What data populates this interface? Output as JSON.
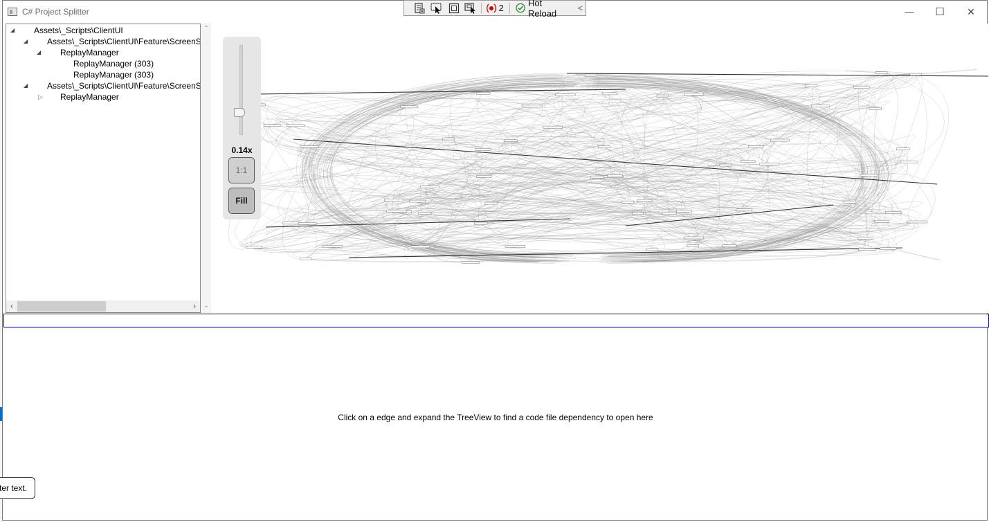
{
  "window": {
    "title": "C# Project Splitter",
    "minimize_glyph": "—",
    "maximize_glyph": "☐",
    "close_glyph": "✕"
  },
  "debug_toolbar": {
    "icons": [
      "live-visual-tree-icon",
      "select-element-icon",
      "display-layout-adorners-icon",
      "track-focus-icon"
    ],
    "issue_count": "2",
    "hot_reload_label": "Hot Reload",
    "collapse_glyph": "<"
  },
  "tree": {
    "items": [
      {
        "label": "Assets\\_Scripts\\ClientUI",
        "level": 0,
        "state": "expanded"
      },
      {
        "label": "Assets\\_Scripts\\ClientUI\\Feature\\ScreenSp",
        "level": 1,
        "state": "expanded"
      },
      {
        "label": "ReplayManager",
        "level": 2,
        "state": "expanded"
      },
      {
        "label": "ReplayManager (303)",
        "level": 3,
        "state": "leaf"
      },
      {
        "label": "ReplayManager (303)",
        "level": 3,
        "state": "leaf"
      },
      {
        "label": "Assets\\_Scripts\\ClientUI\\Feature\\ScreenSp",
        "level": 1,
        "state": "expanded"
      },
      {
        "label": "ReplayManager",
        "level": 2,
        "state": "collapsed"
      }
    ]
  },
  "zoom": {
    "level_label": "0.14x",
    "level": 0.14,
    "one_to_one_label": "1:1",
    "fill_label": "Fill"
  },
  "search": {
    "value": "",
    "placeholder": ""
  },
  "code_view": {
    "message": "Click on a edge and expand the TreeView to find a code file dependency to open here"
  },
  "tooltip": {
    "text": "ter text."
  },
  "colors": {
    "search_border": "#0000c8",
    "zoom_panel": "#e6e6e6",
    "graph_edge": "#8c8c8c"
  }
}
